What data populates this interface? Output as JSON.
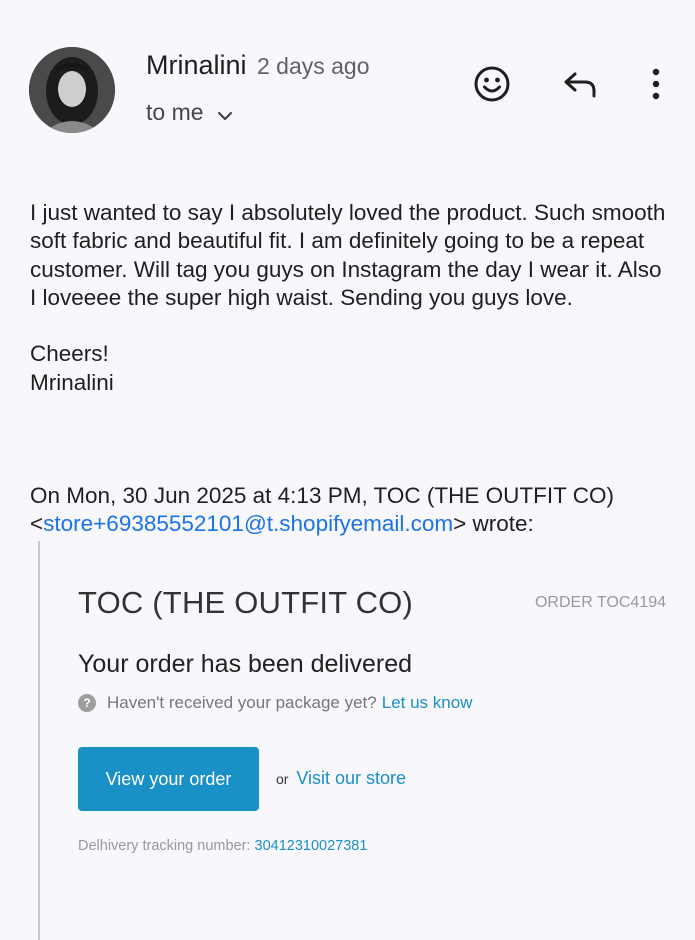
{
  "header": {
    "sender_name": "Mrinalini",
    "time_ago": "2 days ago",
    "recipient": "to me",
    "icons": [
      "avatar",
      "smiley-icon",
      "reply-icon",
      "more-vertical-icon",
      "chevron-down-icon"
    ]
  },
  "message": {
    "paragraph": "I just wanted to say I absolutely loved the product. Such smooth soft fabric and beautiful fit. I am definitely going to be a repeat customer.  Will tag you guys on Instagram the day I wear it. Also I loveeee the super high waist. Sending you guys love.",
    "closing": "Cheers!",
    "signature": "Mrinalini"
  },
  "quote": {
    "intro": "On Mon, 30 Jun 2025 at 4:13 PM, TOC (THE OUTFIT CO)",
    "lt": "<",
    "email": "store+69385552101@t.shopifyemail.com",
    "wrote": "> wrote:"
  },
  "shopify": {
    "store_name": "TOC (THE OUTFIT CO)",
    "order_number": "ORDER TOC4194",
    "heading": "Your order has been delivered",
    "help_icon": "?",
    "help_text": "Haven't received your package yet?",
    "help_link": "Let us know",
    "view_order_label": "View your order",
    "or_text": "or",
    "visit_store_label": "Visit our store",
    "tracking_label": "Delhivery tracking number:",
    "tracking_number": "30412310027381"
  },
  "colors": {
    "background": "#f8f7fc",
    "gmail_link": "#1a73e8",
    "shopify_accent": "#1990c6"
  }
}
